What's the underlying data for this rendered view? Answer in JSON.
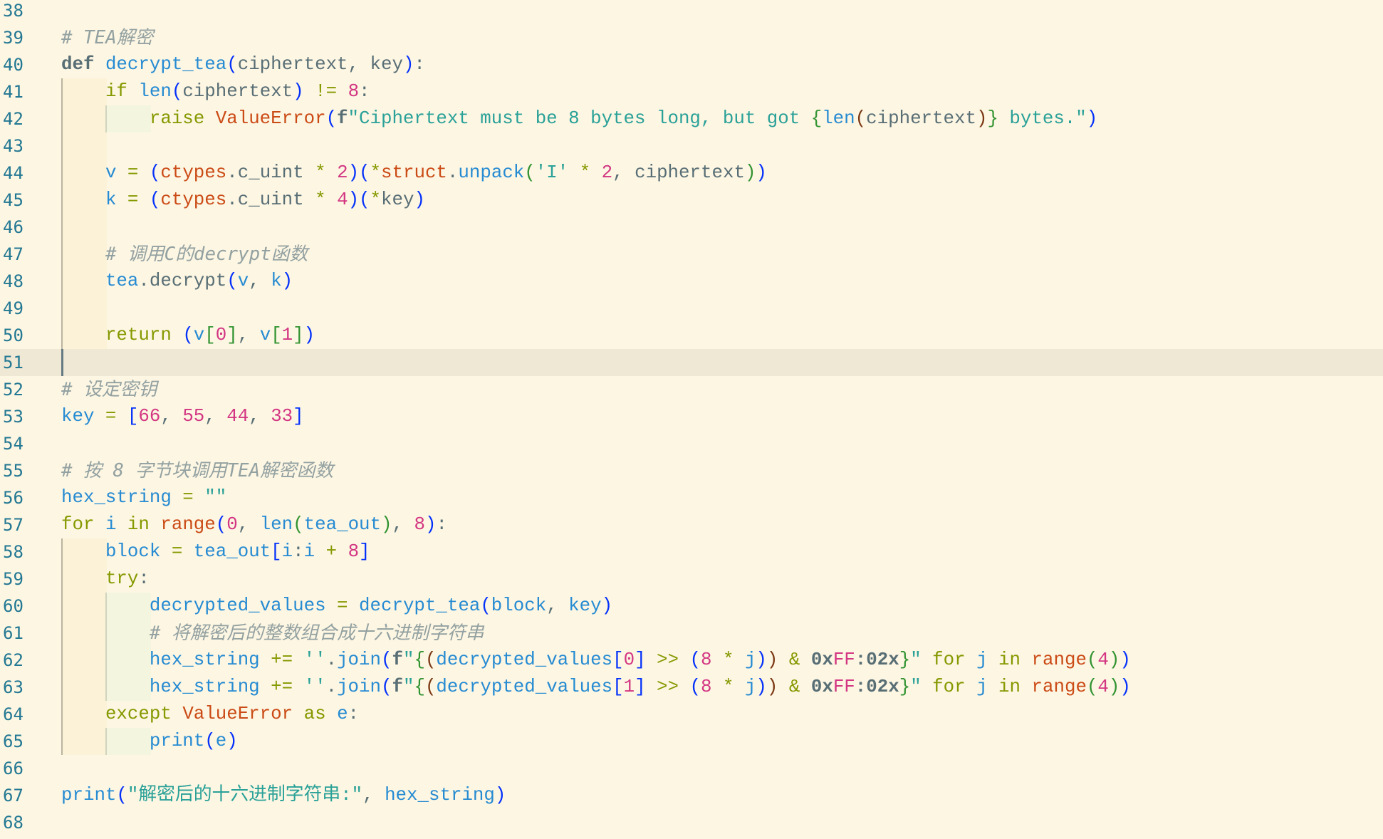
{
  "editor": {
    "theme_colors": {
      "background": "#fdf6e3",
      "line_number": "#237893",
      "keyword": "#859900",
      "function": "#268bd2",
      "number": "#d33682",
      "string": "#2aa198",
      "class": "#cb4b16",
      "comment": "#93a1a1"
    },
    "current_line": 51,
    "lines": [
      {
        "n": "38",
        "indent": 0,
        "tokens": []
      },
      {
        "n": "39",
        "indent": 0,
        "tokens": [
          [
            "cm",
            "# TEA解密"
          ]
        ]
      },
      {
        "n": "40",
        "indent": 0,
        "tokens": [
          [
            "kb",
            "def "
          ],
          [
            "f",
            "decrypt_tea"
          ],
          [
            "p1",
            "("
          ],
          [
            "t",
            "ciphertext, key"
          ],
          [
            "p1",
            ")"
          ],
          [
            "t",
            ":"
          ]
        ]
      },
      {
        "n": "41",
        "indent": 1,
        "tokens": [
          [
            "t",
            "    "
          ],
          [
            "k",
            "if "
          ],
          [
            "f",
            "len"
          ],
          [
            "p1",
            "("
          ],
          [
            "t",
            "ciphertext"
          ],
          [
            "p1",
            ")"
          ],
          [
            "k",
            " != "
          ],
          [
            "n",
            "8"
          ],
          [
            "t",
            ":"
          ]
        ]
      },
      {
        "n": "42",
        "indent": 2,
        "tokens": [
          [
            "t",
            "        "
          ],
          [
            "k",
            "raise "
          ],
          [
            "c",
            "ValueError"
          ],
          [
            "p1",
            "("
          ],
          [
            "kb",
            "f"
          ],
          [
            "s",
            "\"Ciphertext must be 8 bytes long, but got "
          ],
          [
            "p2",
            "{"
          ],
          [
            "f",
            "len"
          ],
          [
            "p3",
            "("
          ],
          [
            "t",
            "ciphertext"
          ],
          [
            "p3",
            ")"
          ],
          [
            "p2",
            "}"
          ],
          [
            "s",
            " bytes.\""
          ],
          [
            "p1",
            ")"
          ]
        ]
      },
      {
        "n": "43",
        "indent": 1,
        "tokens": []
      },
      {
        "n": "44",
        "indent": 1,
        "tokens": [
          [
            "t",
            "    "
          ],
          [
            "f",
            "v"
          ],
          [
            "k",
            " = "
          ],
          [
            "p1",
            "("
          ],
          [
            "c",
            "ctypes"
          ],
          [
            "t",
            ".c_uint "
          ],
          [
            "k",
            "* "
          ],
          [
            "n",
            "2"
          ],
          [
            "p1",
            ")"
          ],
          [
            "p1",
            "("
          ],
          [
            "k",
            "*"
          ],
          [
            "c",
            "struct"
          ],
          [
            "t",
            "."
          ],
          [
            "f",
            "unpack"
          ],
          [
            "p2",
            "("
          ],
          [
            "s",
            "'I'"
          ],
          [
            "k",
            " * "
          ],
          [
            "n",
            "2"
          ],
          [
            "t",
            ", ciphertext"
          ],
          [
            "p2",
            ")"
          ],
          [
            "p1",
            ")"
          ]
        ]
      },
      {
        "n": "45",
        "indent": 1,
        "tokens": [
          [
            "t",
            "    "
          ],
          [
            "f",
            "k"
          ],
          [
            "k",
            " = "
          ],
          [
            "p1",
            "("
          ],
          [
            "c",
            "ctypes"
          ],
          [
            "t",
            ".c_uint "
          ],
          [
            "k",
            "* "
          ],
          [
            "n",
            "4"
          ],
          [
            "p1",
            ")"
          ],
          [
            "p1",
            "("
          ],
          [
            "k",
            "*"
          ],
          [
            "t",
            "key"
          ],
          [
            "p1",
            ")"
          ]
        ]
      },
      {
        "n": "46",
        "indent": 1,
        "tokens": []
      },
      {
        "n": "47",
        "indent": 1,
        "tokens": [
          [
            "t",
            "    "
          ],
          [
            "cm",
            "# 调用C的decrypt函数"
          ]
        ]
      },
      {
        "n": "48",
        "indent": 1,
        "tokens": [
          [
            "t",
            "    "
          ],
          [
            "f",
            "tea"
          ],
          [
            "t",
            ".decrypt"
          ],
          [
            "p1",
            "("
          ],
          [
            "f",
            "v"
          ],
          [
            "t",
            ", "
          ],
          [
            "f",
            "k"
          ],
          [
            "p1",
            ")"
          ]
        ]
      },
      {
        "n": "49",
        "indent": 1,
        "tokens": []
      },
      {
        "n": "50",
        "indent": 1,
        "tokens": [
          [
            "t",
            "    "
          ],
          [
            "k",
            "return "
          ],
          [
            "p1",
            "("
          ],
          [
            "f",
            "v"
          ],
          [
            "p2",
            "["
          ],
          [
            "n",
            "0"
          ],
          [
            "p2",
            "]"
          ],
          [
            "t",
            ", "
          ],
          [
            "f",
            "v"
          ],
          [
            "p2",
            "["
          ],
          [
            "n",
            "1"
          ],
          [
            "p2",
            "]"
          ],
          [
            "p1",
            ")"
          ]
        ]
      },
      {
        "n": "51",
        "indent": 0,
        "tokens": []
      },
      {
        "n": "52",
        "indent": 0,
        "tokens": [
          [
            "cm",
            "# 设定密钥"
          ]
        ]
      },
      {
        "n": "53",
        "indent": 0,
        "tokens": [
          [
            "f",
            "key"
          ],
          [
            "k",
            " = "
          ],
          [
            "p1",
            "["
          ],
          [
            "n",
            "66"
          ],
          [
            "t",
            ", "
          ],
          [
            "n",
            "55"
          ],
          [
            "t",
            ", "
          ],
          [
            "n",
            "44"
          ],
          [
            "t",
            ", "
          ],
          [
            "n",
            "33"
          ],
          [
            "p1",
            "]"
          ]
        ]
      },
      {
        "n": "54",
        "indent": 0,
        "tokens": []
      },
      {
        "n": "55",
        "indent": 0,
        "tokens": [
          [
            "cm",
            "# 按 8 字节块调用TEA解密函数"
          ]
        ]
      },
      {
        "n": "56",
        "indent": 0,
        "tokens": [
          [
            "f",
            "hex_string"
          ],
          [
            "k",
            " = "
          ],
          [
            "s",
            "\"\""
          ]
        ]
      },
      {
        "n": "57",
        "indent": 0,
        "tokens": [
          [
            "k",
            "for "
          ],
          [
            "f",
            "i"
          ],
          [
            "k",
            " in "
          ],
          [
            "c",
            "range"
          ],
          [
            "p1",
            "("
          ],
          [
            "n",
            "0"
          ],
          [
            "t",
            ", "
          ],
          [
            "f",
            "len"
          ],
          [
            "p2",
            "("
          ],
          [
            "f",
            "tea_out"
          ],
          [
            "p2",
            ")"
          ],
          [
            "t",
            ", "
          ],
          [
            "n",
            "8"
          ],
          [
            "p1",
            ")"
          ],
          [
            "t",
            ":"
          ]
        ]
      },
      {
        "n": "58",
        "indent": 1,
        "tokens": [
          [
            "t",
            "    "
          ],
          [
            "f",
            "block"
          ],
          [
            "k",
            " = "
          ],
          [
            "f",
            "tea_out"
          ],
          [
            "p1",
            "["
          ],
          [
            "f",
            "i"
          ],
          [
            "t",
            ":"
          ],
          [
            "f",
            "i"
          ],
          [
            "k",
            " + "
          ],
          [
            "n",
            "8"
          ],
          [
            "p1",
            "]"
          ]
        ]
      },
      {
        "n": "59",
        "indent": 1,
        "tokens": [
          [
            "t",
            "    "
          ],
          [
            "k",
            "try"
          ],
          [
            "t",
            ":"
          ]
        ]
      },
      {
        "n": "60",
        "indent": 2,
        "tokens": [
          [
            "t",
            "        "
          ],
          [
            "f",
            "decrypted_values"
          ],
          [
            "k",
            " = "
          ],
          [
            "f",
            "decrypt_tea"
          ],
          [
            "p1",
            "("
          ],
          [
            "f",
            "block"
          ],
          [
            "t",
            ", "
          ],
          [
            "f",
            "key"
          ],
          [
            "p1",
            ")"
          ]
        ]
      },
      {
        "n": "61",
        "indent": 2,
        "tokens": [
          [
            "t",
            "        "
          ],
          [
            "cm",
            "# 将解密后的整数组合成十六进制字符串"
          ]
        ]
      },
      {
        "n": "62",
        "indent": 2,
        "tokens": [
          [
            "t",
            "        "
          ],
          [
            "f",
            "hex_string"
          ],
          [
            "k",
            " += "
          ],
          [
            "s",
            "''"
          ],
          [
            "t",
            "."
          ],
          [
            "f",
            "join"
          ],
          [
            "p1",
            "("
          ],
          [
            "kb",
            "f"
          ],
          [
            "s",
            "\""
          ],
          [
            "p2",
            "{"
          ],
          [
            "p3",
            "("
          ],
          [
            "f",
            "decrypted_values"
          ],
          [
            "p1",
            "["
          ],
          [
            "n",
            "0"
          ],
          [
            "p1",
            "]"
          ],
          [
            "k",
            " >> "
          ],
          [
            "p1",
            "("
          ],
          [
            "n",
            "8"
          ],
          [
            "k",
            " * "
          ],
          [
            "f",
            "j"
          ],
          [
            "p1",
            ")"
          ],
          [
            "p3",
            ")"
          ],
          [
            "k",
            " & "
          ],
          [
            "kb",
            "0x"
          ],
          [
            "n",
            "FF"
          ],
          [
            "kb",
            ":02x"
          ],
          [
            "p2",
            "}"
          ],
          [
            "s",
            "\""
          ],
          [
            "k",
            " for "
          ],
          [
            "f",
            "j"
          ],
          [
            "k",
            " in "
          ],
          [
            "c",
            "range"
          ],
          [
            "p2",
            "("
          ],
          [
            "n",
            "4"
          ],
          [
            "p2",
            ")"
          ],
          [
            "p1",
            ")"
          ]
        ]
      },
      {
        "n": "63",
        "indent": 2,
        "tokens": [
          [
            "t",
            "        "
          ],
          [
            "f",
            "hex_string"
          ],
          [
            "k",
            " += "
          ],
          [
            "s",
            "''"
          ],
          [
            "t",
            "."
          ],
          [
            "f",
            "join"
          ],
          [
            "p1",
            "("
          ],
          [
            "kb",
            "f"
          ],
          [
            "s",
            "\""
          ],
          [
            "p2",
            "{"
          ],
          [
            "p3",
            "("
          ],
          [
            "f",
            "decrypted_values"
          ],
          [
            "p1",
            "["
          ],
          [
            "n",
            "1"
          ],
          [
            "p1",
            "]"
          ],
          [
            "k",
            " >> "
          ],
          [
            "p1",
            "("
          ],
          [
            "n",
            "8"
          ],
          [
            "k",
            " * "
          ],
          [
            "f",
            "j"
          ],
          [
            "p1",
            ")"
          ],
          [
            "p3",
            ")"
          ],
          [
            "k",
            " & "
          ],
          [
            "kb",
            "0x"
          ],
          [
            "n",
            "FF"
          ],
          [
            "kb",
            ":02x"
          ],
          [
            "p2",
            "}"
          ],
          [
            "s",
            "\""
          ],
          [
            "k",
            " for "
          ],
          [
            "f",
            "j"
          ],
          [
            "k",
            " in "
          ],
          [
            "c",
            "range"
          ],
          [
            "p2",
            "("
          ],
          [
            "n",
            "4"
          ],
          [
            "p2",
            ")"
          ],
          [
            "p1",
            ")"
          ]
        ]
      },
      {
        "n": "64",
        "indent": 1,
        "tokens": [
          [
            "t",
            "    "
          ],
          [
            "k",
            "except "
          ],
          [
            "c",
            "ValueError"
          ],
          [
            "k",
            " as "
          ],
          [
            "f",
            "e"
          ],
          [
            "t",
            ":"
          ]
        ]
      },
      {
        "n": "65",
        "indent": 2,
        "tokens": [
          [
            "t",
            "        "
          ],
          [
            "f",
            "print"
          ],
          [
            "p1",
            "("
          ],
          [
            "f",
            "e"
          ],
          [
            "p1",
            ")"
          ]
        ]
      },
      {
        "n": "66",
        "indent": 0,
        "tokens": []
      },
      {
        "n": "67",
        "indent": 0,
        "tokens": [
          [
            "f",
            "print"
          ],
          [
            "p1",
            "("
          ],
          [
            "s",
            "\"解密后的十六进制字符串:\""
          ],
          [
            "t",
            ", "
          ],
          [
            "f",
            "hex_string"
          ],
          [
            "p1",
            ")"
          ]
        ]
      },
      {
        "n": "68",
        "indent": 0,
        "tokens": []
      }
    ]
  }
}
